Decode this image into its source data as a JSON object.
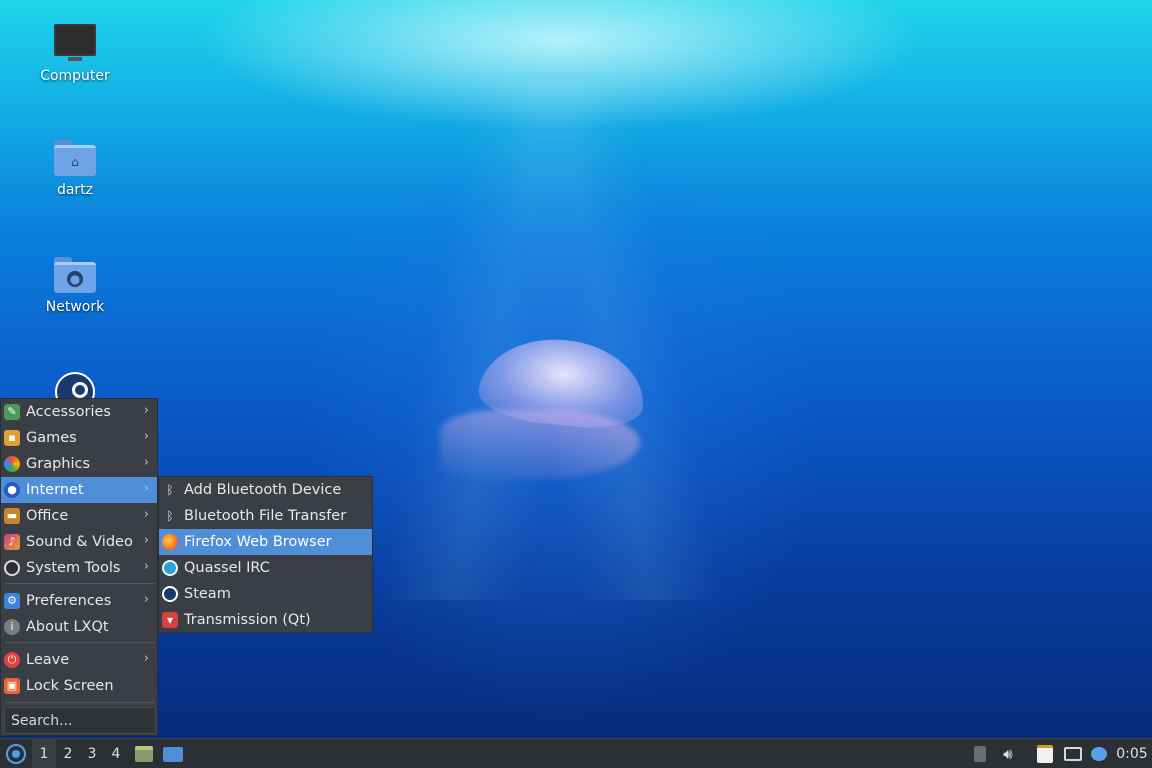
{
  "desktop": {
    "icons": [
      {
        "label": "Computer",
        "icon": "computer-icon"
      },
      {
        "label": "dartz",
        "icon": "home-folder-icon"
      },
      {
        "label": "Network",
        "icon": "network-folder-icon"
      },
      {
        "label": "",
        "icon": "steam-icon"
      }
    ]
  },
  "menu": {
    "items": [
      {
        "label": "Accessories",
        "icon": "accessories-icon",
        "has_submenu": true
      },
      {
        "label": "Games",
        "icon": "games-icon",
        "has_submenu": true
      },
      {
        "label": "Graphics",
        "icon": "graphics-icon",
        "has_submenu": true
      },
      {
        "label": "Internet",
        "icon": "internet-icon",
        "has_submenu": true,
        "active": true
      },
      {
        "label": "Office",
        "icon": "office-icon",
        "has_submenu": true
      },
      {
        "label": "Sound & Video",
        "icon": "sound-video-icon",
        "has_submenu": true
      },
      {
        "label": "System Tools",
        "icon": "system-tools-icon",
        "has_submenu": true
      },
      {
        "label": "Preferences",
        "icon": "preferences-icon",
        "has_submenu": true
      },
      {
        "label": "About LXQt",
        "icon": "info-icon",
        "has_submenu": false
      },
      {
        "label": "Leave",
        "icon": "power-icon",
        "has_submenu": true
      },
      {
        "label": "Lock Screen",
        "icon": "lock-icon",
        "has_submenu": false
      }
    ],
    "search_placeholder": "Search...",
    "submenu_arrow": "›"
  },
  "submenu": {
    "items": [
      {
        "label": "Add Bluetooth Device",
        "icon": "bluetooth-icon"
      },
      {
        "label": "Bluetooth File Transfer",
        "icon": "bluetooth-icon"
      },
      {
        "label": "Firefox Web Browser",
        "icon": "firefox-icon",
        "active": true
      },
      {
        "label": "Quassel IRC",
        "icon": "quassel-icon"
      },
      {
        "label": "Steam",
        "icon": "steam-icon"
      },
      {
        "label": "Transmission (Qt)",
        "icon": "transmission-icon"
      }
    ]
  },
  "taskbar": {
    "workspaces": [
      "1",
      "2",
      "3",
      "4"
    ],
    "current_workspace": "1",
    "clock": "0:05"
  },
  "colors": {
    "menu_bg": "#3b3f45",
    "highlight": "#4f8ed8",
    "taskbar_bg": "#2c2f34"
  }
}
